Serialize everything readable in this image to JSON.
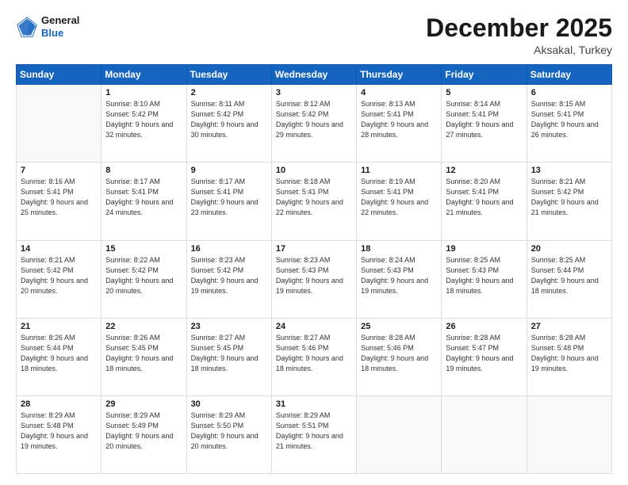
{
  "header": {
    "logo_line1": "General",
    "logo_line2": "Blue",
    "month": "December 2025",
    "location": "Aksakal, Turkey"
  },
  "weekdays": [
    "Sunday",
    "Monday",
    "Tuesday",
    "Wednesday",
    "Thursday",
    "Friday",
    "Saturday"
  ],
  "weeks": [
    [
      {
        "day": "",
        "sunrise": "",
        "sunset": "",
        "daylight": ""
      },
      {
        "day": "1",
        "sunrise": "Sunrise: 8:10 AM",
        "sunset": "Sunset: 5:42 PM",
        "daylight": "Daylight: 9 hours and 32 minutes."
      },
      {
        "day": "2",
        "sunrise": "Sunrise: 8:11 AM",
        "sunset": "Sunset: 5:42 PM",
        "daylight": "Daylight: 9 hours and 30 minutes."
      },
      {
        "day": "3",
        "sunrise": "Sunrise: 8:12 AM",
        "sunset": "Sunset: 5:42 PM",
        "daylight": "Daylight: 9 hours and 29 minutes."
      },
      {
        "day": "4",
        "sunrise": "Sunrise: 8:13 AM",
        "sunset": "Sunset: 5:41 PM",
        "daylight": "Daylight: 9 hours and 28 minutes."
      },
      {
        "day": "5",
        "sunrise": "Sunrise: 8:14 AM",
        "sunset": "Sunset: 5:41 PM",
        "daylight": "Daylight: 9 hours and 27 minutes."
      },
      {
        "day": "6",
        "sunrise": "Sunrise: 8:15 AM",
        "sunset": "Sunset: 5:41 PM",
        "daylight": "Daylight: 9 hours and 26 minutes."
      }
    ],
    [
      {
        "day": "7",
        "sunrise": "Sunrise: 8:16 AM",
        "sunset": "Sunset: 5:41 PM",
        "daylight": "Daylight: 9 hours and 25 minutes."
      },
      {
        "day": "8",
        "sunrise": "Sunrise: 8:17 AM",
        "sunset": "Sunset: 5:41 PM",
        "daylight": "Daylight: 9 hours and 24 minutes."
      },
      {
        "day": "9",
        "sunrise": "Sunrise: 8:17 AM",
        "sunset": "Sunset: 5:41 PM",
        "daylight": "Daylight: 9 hours and 23 minutes."
      },
      {
        "day": "10",
        "sunrise": "Sunrise: 8:18 AM",
        "sunset": "Sunset: 5:41 PM",
        "daylight": "Daylight: 9 hours and 22 minutes."
      },
      {
        "day": "11",
        "sunrise": "Sunrise: 8:19 AM",
        "sunset": "Sunset: 5:41 PM",
        "daylight": "Daylight: 9 hours and 22 minutes."
      },
      {
        "day": "12",
        "sunrise": "Sunrise: 8:20 AM",
        "sunset": "Sunset: 5:41 PM",
        "daylight": "Daylight: 9 hours and 21 minutes."
      },
      {
        "day": "13",
        "sunrise": "Sunrise: 8:21 AM",
        "sunset": "Sunset: 5:42 PM",
        "daylight": "Daylight: 9 hours and 21 minutes."
      }
    ],
    [
      {
        "day": "14",
        "sunrise": "Sunrise: 8:21 AM",
        "sunset": "Sunset: 5:42 PM",
        "daylight": "Daylight: 9 hours and 20 minutes."
      },
      {
        "day": "15",
        "sunrise": "Sunrise: 8:22 AM",
        "sunset": "Sunset: 5:42 PM",
        "daylight": "Daylight: 9 hours and 20 minutes."
      },
      {
        "day": "16",
        "sunrise": "Sunrise: 8:23 AM",
        "sunset": "Sunset: 5:42 PM",
        "daylight": "Daylight: 9 hours and 19 minutes."
      },
      {
        "day": "17",
        "sunrise": "Sunrise: 8:23 AM",
        "sunset": "Sunset: 5:43 PM",
        "daylight": "Daylight: 9 hours and 19 minutes."
      },
      {
        "day": "18",
        "sunrise": "Sunrise: 8:24 AM",
        "sunset": "Sunset: 5:43 PM",
        "daylight": "Daylight: 9 hours and 19 minutes."
      },
      {
        "day": "19",
        "sunrise": "Sunrise: 8:25 AM",
        "sunset": "Sunset: 5:43 PM",
        "daylight": "Daylight: 9 hours and 18 minutes."
      },
      {
        "day": "20",
        "sunrise": "Sunrise: 8:25 AM",
        "sunset": "Sunset: 5:44 PM",
        "daylight": "Daylight: 9 hours and 18 minutes."
      }
    ],
    [
      {
        "day": "21",
        "sunrise": "Sunrise: 8:26 AM",
        "sunset": "Sunset: 5:44 PM",
        "daylight": "Daylight: 9 hours and 18 minutes."
      },
      {
        "day": "22",
        "sunrise": "Sunrise: 8:26 AM",
        "sunset": "Sunset: 5:45 PM",
        "daylight": "Daylight: 9 hours and 18 minutes."
      },
      {
        "day": "23",
        "sunrise": "Sunrise: 8:27 AM",
        "sunset": "Sunset: 5:45 PM",
        "daylight": "Daylight: 9 hours and 18 minutes."
      },
      {
        "day": "24",
        "sunrise": "Sunrise: 8:27 AM",
        "sunset": "Sunset: 5:46 PM",
        "daylight": "Daylight: 9 hours and 18 minutes."
      },
      {
        "day": "25",
        "sunrise": "Sunrise: 8:28 AM",
        "sunset": "Sunset: 5:46 PM",
        "daylight": "Daylight: 9 hours and 18 minutes."
      },
      {
        "day": "26",
        "sunrise": "Sunrise: 8:28 AM",
        "sunset": "Sunset: 5:47 PM",
        "daylight": "Daylight: 9 hours and 19 minutes."
      },
      {
        "day": "27",
        "sunrise": "Sunrise: 8:28 AM",
        "sunset": "Sunset: 5:48 PM",
        "daylight": "Daylight: 9 hours and 19 minutes."
      }
    ],
    [
      {
        "day": "28",
        "sunrise": "Sunrise: 8:29 AM",
        "sunset": "Sunset: 5:48 PM",
        "daylight": "Daylight: 9 hours and 19 minutes."
      },
      {
        "day": "29",
        "sunrise": "Sunrise: 8:29 AM",
        "sunset": "Sunset: 5:49 PM",
        "daylight": "Daylight: 9 hours and 20 minutes."
      },
      {
        "day": "30",
        "sunrise": "Sunrise: 8:29 AM",
        "sunset": "Sunset: 5:50 PM",
        "daylight": "Daylight: 9 hours and 20 minutes."
      },
      {
        "day": "31",
        "sunrise": "Sunrise: 8:29 AM",
        "sunset": "Sunset: 5:51 PM",
        "daylight": "Daylight: 9 hours and 21 minutes."
      },
      {
        "day": "",
        "sunrise": "",
        "sunset": "",
        "daylight": ""
      },
      {
        "day": "",
        "sunrise": "",
        "sunset": "",
        "daylight": ""
      },
      {
        "day": "",
        "sunrise": "",
        "sunset": "",
        "daylight": ""
      }
    ]
  ]
}
